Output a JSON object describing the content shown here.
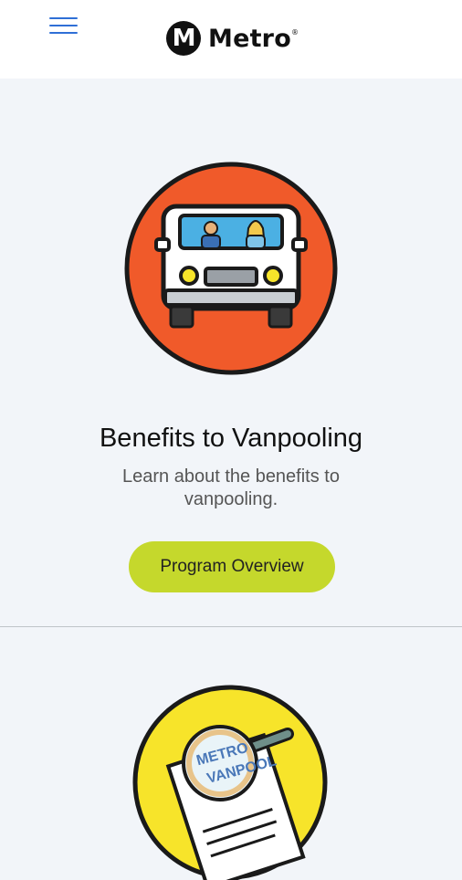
{
  "header": {
    "logo_mark": "M",
    "logo_text": "Metro",
    "logo_reg": "®",
    "menu_icon": "hamburger-menu-icon"
  },
  "cards": [
    {
      "title": "Benefits to Vanpooling",
      "description": "Learn about the benefits to vanpooling.",
      "button_label": "Program Overview",
      "illustration": "van-icon"
    },
    {
      "illustration": "magnifier-document-icon",
      "illustration_text": "METRO VANPOOL"
    }
  ],
  "colors": {
    "accent_button": "#c5d82c",
    "menu_icon": "#2f6fd6",
    "van_circle": "#f05a2a",
    "doc_circle": "#f7e42a",
    "page_background": "#f2f5f9"
  }
}
